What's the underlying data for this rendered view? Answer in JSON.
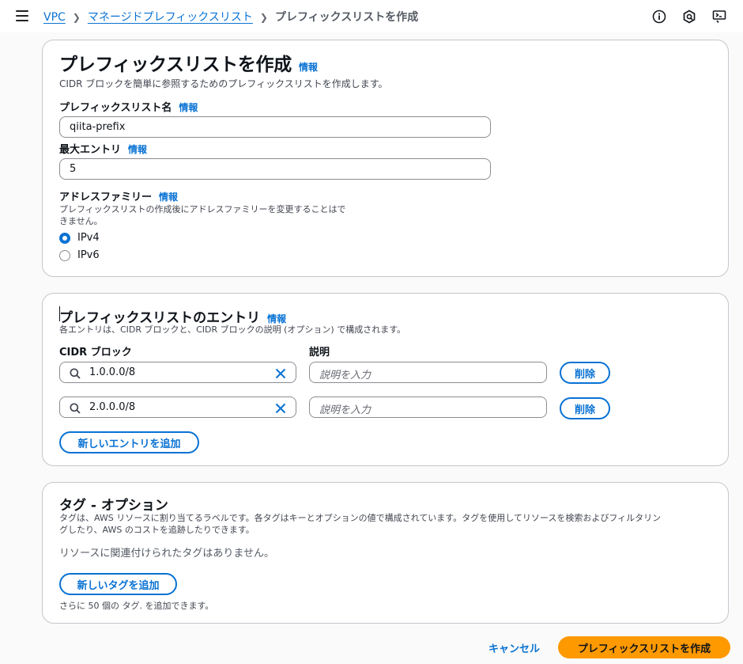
{
  "breadcrumb": {
    "items": [
      "VPC",
      "マネージドプレフィックスリスト"
    ],
    "current": "プレフィックスリストを作成"
  },
  "header_icons": [
    "info-circle-icon",
    "notifications-icon",
    "feedback-icon"
  ],
  "info_label": "情報",
  "settings": {
    "title": "プレフィックスリストを作成",
    "description": "CIDR ブロックを簡単に参照するためのプレフィックスリストを作成します。",
    "name_label": "プレフィックスリスト名",
    "name_value": "qiita-prefix",
    "max_entries_label": "最大エントリ",
    "max_entries_value": "5",
    "address_family_label": "アドレスファミリー",
    "address_family_desc_1": "プレフィックスリストの作成後にアドレスファミリーを変更することはで",
    "address_family_desc_2": "きません。",
    "options": [
      {
        "label": "IPv4",
        "selected": true
      },
      {
        "label": "IPv6",
        "selected": false
      }
    ]
  },
  "entries": {
    "title": "プレフィックスリストのエントリ",
    "description": "各エントリは、CIDR ブロックと、CIDR ブロックの説明 (オプション) で構成されます。",
    "cidr_label": "CIDR ブロック",
    "desc_label": "説明",
    "rows": [
      {
        "cidr": "1.0.0.0/8",
        "desc_placeholder": "説明を入力",
        "remove": "削除"
      },
      {
        "cidr": "2.0.0.0/8",
        "desc_placeholder": "説明を入力",
        "remove": "削除"
      }
    ],
    "add_button": "新しいエントリを追加"
  },
  "tags": {
    "title": "タグ - オプション",
    "description_1": "タグは、AWS リソースに割り当てるラベルです。各タグはキーとオプションの値で構成されています。タグを使用してリソースを検索およびフィルタリン",
    "description_2": "グしたり、AWS のコストを追跡したりできます。",
    "empty_text": "リソースに関連付けられたタグはありません。",
    "add_button": "新しいタグを追加",
    "remaining": "さらに 50 個の タグ. を追加できます。"
  },
  "footer": {
    "cancel": "キャンセル",
    "submit": "プレフィックスリストを作成"
  },
  "colors": {
    "accent": "#0972d3",
    "primary_button": "#ff9900"
  }
}
